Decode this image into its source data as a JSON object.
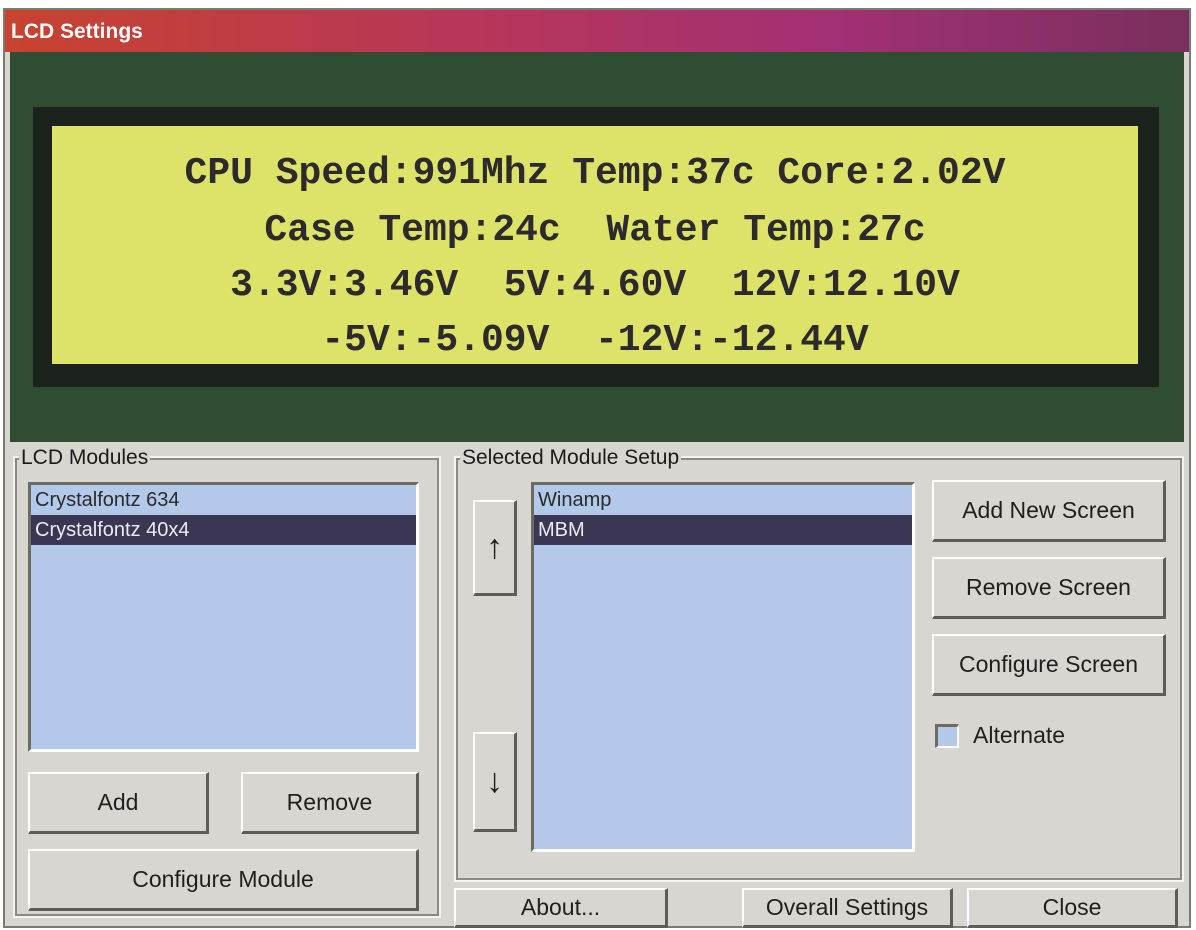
{
  "window": {
    "title": "LCD Settings"
  },
  "lcd": {
    "lines": [
      "CPU Speed:991Mhz Temp:37c Core:2.02V",
      "Case Temp:24c  Water Temp:27c",
      "3.3V:3.46V  5V:4.60V  12V:12.10V",
      "-5V:-5.09V  -12V:-12.44V"
    ],
    "colors": {
      "bezel": "#2f4d33",
      "screen": "#dde268",
      "text": "#2c2a2c"
    }
  },
  "modules": {
    "label": "LCD Modules",
    "items": [
      {
        "label": "Crystalfontz 634",
        "selected": false
      },
      {
        "label": "Crystalfontz 40x4",
        "selected": true
      }
    ],
    "add_label": "Add",
    "remove_label": "Remove",
    "configure_label": "Configure Module"
  },
  "setup": {
    "label": "Selected Module Setup",
    "screens": [
      {
        "label": "Winamp",
        "selected": false
      },
      {
        "label": "MBM",
        "selected": true
      }
    ],
    "add_screen_label": "Add New Screen",
    "remove_screen_label": "Remove Screen",
    "configure_screen_label": "Configure Screen",
    "alternate_label": "Alternate",
    "alternate_checked": false
  },
  "footer": {
    "about_label": "About...",
    "overall_label": "Overall Settings",
    "close_label": "Close"
  },
  "icons": {
    "up": "arrow-up-icon",
    "down": "arrow-down-icon"
  }
}
